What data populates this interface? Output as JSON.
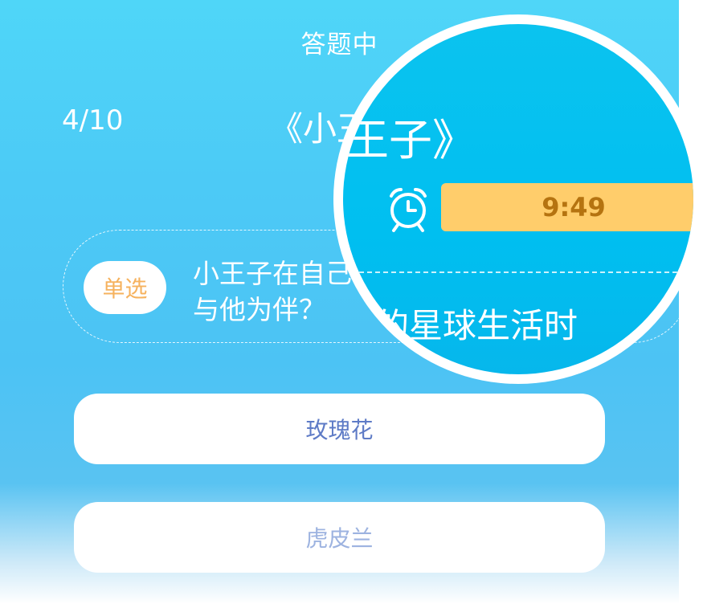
{
  "header": {
    "title": "答题中"
  },
  "quiz": {
    "progress": "4/10",
    "book_title": "《小王子》",
    "timer": "9:49"
  },
  "question": {
    "type_badge": "单选",
    "line1": "小王子在自己",
    "line2": "与他为伴？"
  },
  "options": [
    {
      "label": "玫瑰花"
    },
    {
      "label": "虎皮兰"
    }
  ],
  "magnifier": {
    "book_title_fragment": "《小王子》",
    "text_fragment": "的星球生活时"
  },
  "colors": {
    "background": "#4cc3f4",
    "timer_bar": "#ffcd6b",
    "timer_text": "#b57310",
    "badge_text": "#f6b25e",
    "option_text": "#5e7bc6"
  },
  "icons": {
    "timer": "alarm-clock-icon"
  }
}
